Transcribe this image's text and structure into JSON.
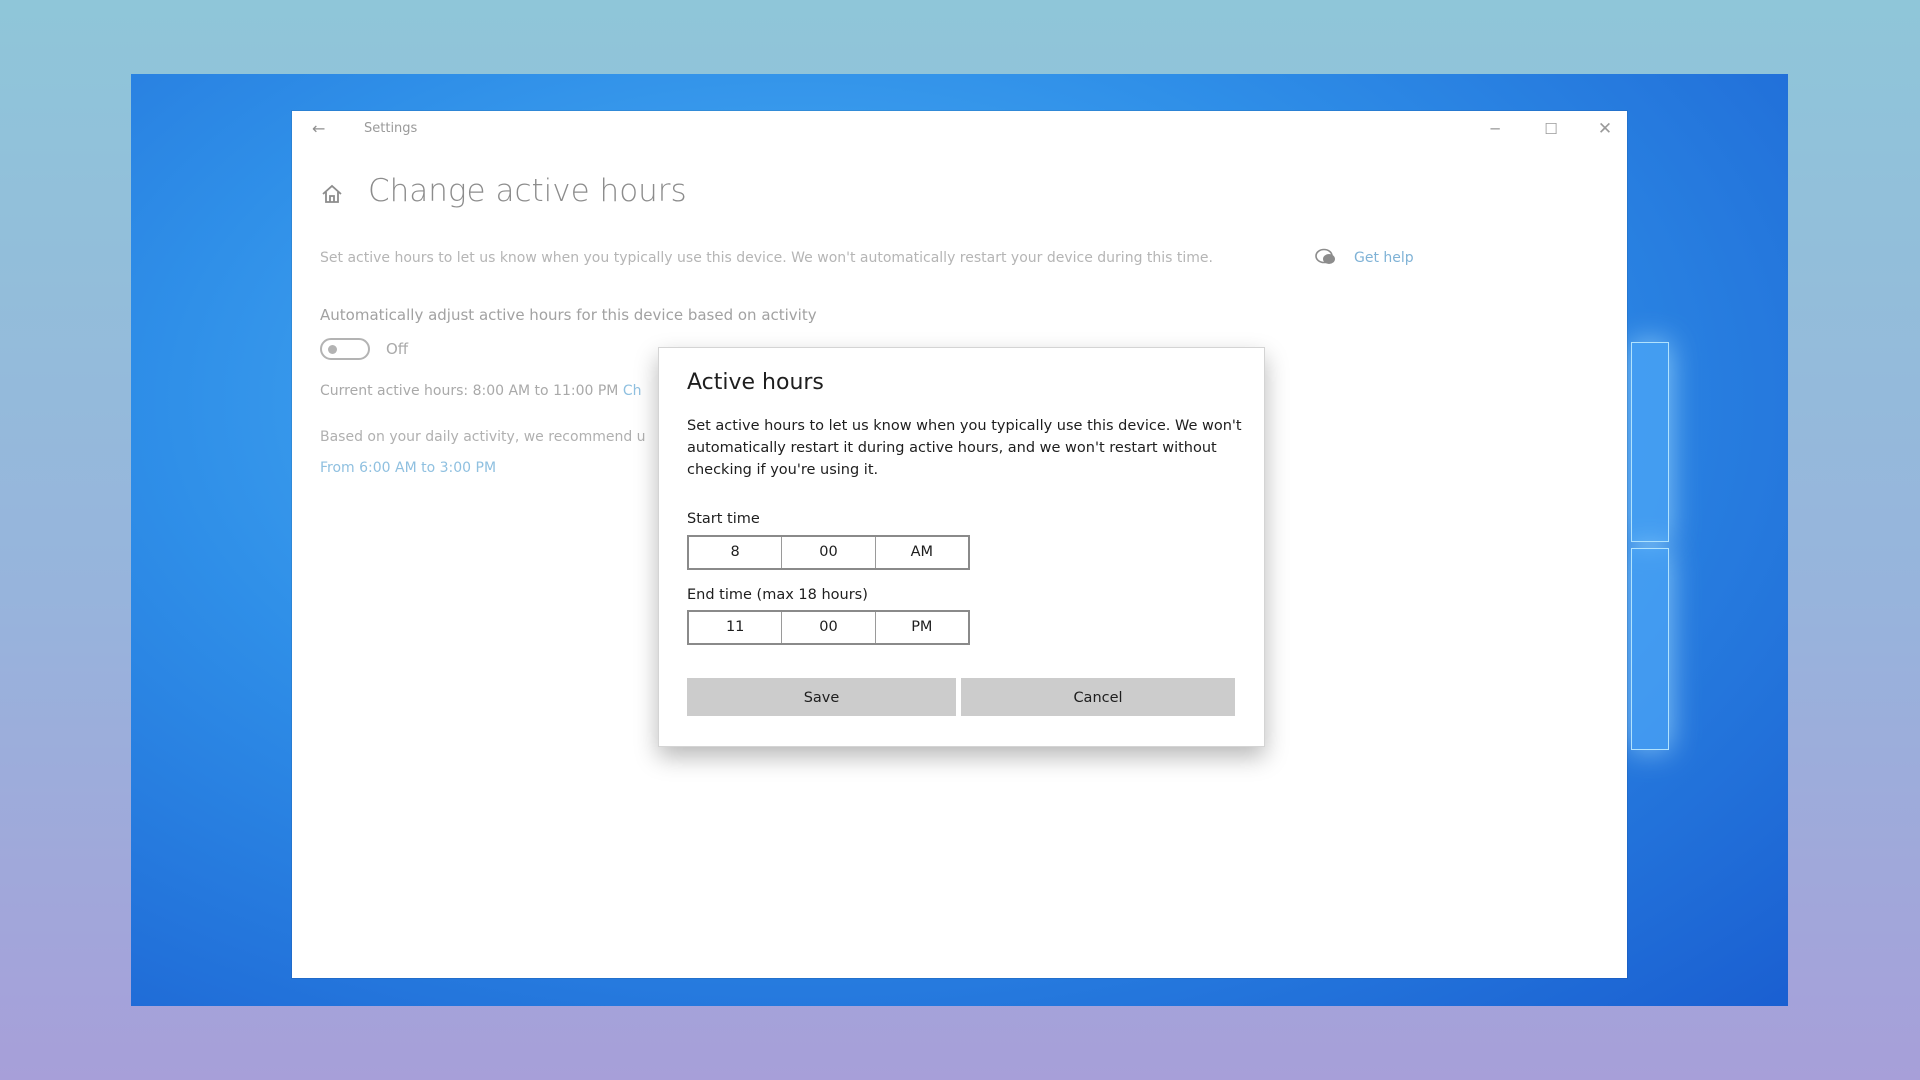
{
  "window": {
    "title": "Settings",
    "back_icon": "back-arrow-icon",
    "controls": {
      "minimize": "─",
      "maximize": "☐",
      "close": "✕"
    }
  },
  "page": {
    "home_icon": "home-icon",
    "title": "Change active hours",
    "description": "Set active hours to let us know when you typically use this device. We won't automatically restart your device during this time.",
    "help_icon": "chat-help-icon",
    "help_link": "Get help",
    "auto_adjust_label": "Automatically adjust active hours for this device based on activity",
    "toggle_state": "Off",
    "current_hours": "Current active hours: 8:00 AM to 11:00 PM",
    "current_change_link": "Ch",
    "recommend_text": "Based on your daily activity, we recommend u",
    "recommend_link": "From 6:00 AM to 3:00 PM"
  },
  "dialog": {
    "title": "Active hours",
    "description": "Set active hours to let us know when you typically use this device. We won't automatically restart it during active hours, and we won't restart without checking if you're using it.",
    "start_label": "Start time",
    "start": {
      "hour": "8",
      "minute": "00",
      "period": "AM"
    },
    "end_label": "End time (max 18 hours)",
    "end": {
      "hour": "11",
      "minute": "00",
      "period": "PM"
    },
    "save_label": "Save",
    "cancel_label": "Cancel"
  },
  "colors": {
    "desktop_blue": "#2f8fe8",
    "link_blue": "#7fb2d6",
    "button_gray": "#cccccc"
  }
}
